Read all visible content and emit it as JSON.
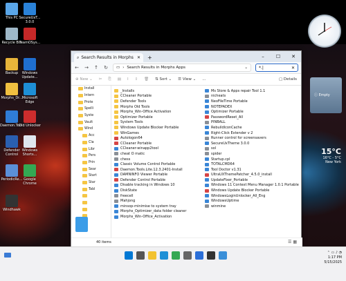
{
  "desktop": {
    "left_icons": [
      {
        "label": "This PC",
        "color": "#5aa6e8"
      },
      {
        "label": "Recycle Bin",
        "color": "#9fb8c8"
      },
      {
        "label": "Backup",
        "color": "#e7b43a"
      },
      {
        "label": "Morphs_Dr...",
        "color": "#f0c040"
      },
      {
        "label": "Daemon.Too...",
        "color": "#2f7cd6"
      },
      {
        "label": "Defender Control",
        "color": "#2a5fb0"
      },
      {
        "label": "PeriodicRe...",
        "color": "#5b8fd8"
      },
      {
        "label": "Windhawk",
        "color": "#333"
      }
    ],
    "right_icons": [
      {
        "label": "SecureUxT... 3.0.0",
        "color": "#2a82d8"
      },
      {
        "label": "TeamOSys...",
        "color": "#c62828"
      },
      {
        "label": "Windows Update...",
        "color": "#1f6fd0"
      },
      {
        "label": "Microsoft Edge",
        "color": "#1e8fd6"
      },
      {
        "label": "Old Unlocker",
        "color": "#cc2d2d"
      },
      {
        "label": "Windows Shorts...",
        "color": "#e0e6ee"
      },
      {
        "label": "Google Chrome",
        "color": "#34a853"
      }
    ]
  },
  "gadgets": {
    "empty_label": "Empty",
    "weather": {
      "temp": "15°C",
      "range": "16°C - 5°C",
      "city": "New York"
    }
  },
  "explorer": {
    "tab_title": "Search Results in Morphs",
    "address": "Search Results in Morphs Apps",
    "search_value": "*.|",
    "toolbar": {
      "new": "New",
      "sort": "Sort",
      "view": "View",
      "more": "...",
      "details": "Details"
    },
    "nav_items": [
      "Install",
      "Intern",
      "Prote",
      "Spelli",
      "Syste",
      "Vault",
      "Wind",
      "Acc",
      "Cla",
      "Libr",
      "Pers",
      "Prin",
      "Sear",
      "Start",
      "Star",
      "Tabl",
      "",
      "",
      "",
      "",
      "",
      ""
    ],
    "files_col1": [
      {
        "name": "_Installs",
        "icon": "folder"
      },
      {
        "name": "CCleaner Portable",
        "icon": "folder"
      },
      {
        "name": "Defender Tools",
        "icon": "folder"
      },
      {
        "name": "Morphs Old Tools",
        "icon": "folder"
      },
      {
        "name": "Morphs_Win-Office Activation",
        "icon": "folder"
      },
      {
        "name": "Optimizer Portable",
        "icon": "folder"
      },
      {
        "name": "System Tools",
        "icon": "folder"
      },
      {
        "name": "Windows Update Blocker Portable",
        "icon": "folder"
      },
      {
        "name": "WinGames",
        "icon": "folder"
      },
      {
        "name": "Autologon64",
        "icon": "app-red"
      },
      {
        "name": "CCleaner Portable",
        "icon": "app-red"
      },
      {
        "name": "CCleaner-winapp2tool",
        "icon": "app-blue"
      },
      {
        "name": "cheat O matic",
        "icon": "app-gray"
      },
      {
        "name": "chess",
        "icon": "app-gray"
      },
      {
        "name": "Classic Volume Control Portable",
        "icon": "app-blue"
      },
      {
        "name": "Daemon.Tools.Lite.12.3.2401-Install",
        "icon": "app-red"
      },
      {
        "name": "DAMNINFO Viewer Portable",
        "icon": "app-blue"
      },
      {
        "name": "Defender Control Portable",
        "icon": "app-red"
      },
      {
        "name": "Disable tracking in Windows 10",
        "icon": "app-blue"
      },
      {
        "name": "DiskState",
        "icon": "app-blue"
      },
      {
        "name": "freecell",
        "icon": "app-gray"
      },
      {
        "name": "Mahjong",
        "icon": "app-gray"
      },
      {
        "name": "minsop-minimise to system tray",
        "icon": "app-blue"
      },
      {
        "name": "Morphs_Optimizer_data folder cleaner",
        "icon": "app-blue"
      },
      {
        "name": "Morphs_Win-Office_Activation",
        "icon": "app-blue"
      }
    ],
    "files_col2": [
      {
        "name": "Ms Store & Apps repair Tool 1.1",
        "icon": "app-blue"
      },
      {
        "name": "nicheats",
        "icon": "app-gray"
      },
      {
        "name": "NeoFileTime Portable",
        "icon": "app-blue"
      },
      {
        "name": "NOTEPADEX",
        "icon": "app-blue"
      },
      {
        "name": "Optimizer Portable",
        "icon": "app-blue"
      },
      {
        "name": "PasswordReset_All",
        "icon": "app-red"
      },
      {
        "name": "PINBALL",
        "icon": "app-gray"
      },
      {
        "name": "RebuildIconCache",
        "icon": "app-blue"
      },
      {
        "name": "Right-Click Extender v 2",
        "icon": "app-blue"
      },
      {
        "name": "Runner control for screensavers",
        "icon": "app-gray"
      },
      {
        "name": "SecureUxTheme 3.0.0",
        "icon": "app-blue"
      },
      {
        "name": "sol",
        "icon": "app-gray"
      },
      {
        "name": "spider",
        "icon": "app-gray"
      },
      {
        "name": "Startup.cpl",
        "icon": "app-blue"
      },
      {
        "name": "TOTALCMD64",
        "icon": "app-blue"
      },
      {
        "name": "Tool Doctor v1.31",
        "icon": "app-blue"
      },
      {
        "name": "UltraUXThemePatcher_4.5.0_install",
        "icon": "app-red"
      },
      {
        "name": "UpdateFixer_Portable",
        "icon": "app-blue"
      },
      {
        "name": "Windows 11 Context Menu Manager 1.0.1 Portable",
        "icon": "app-blue"
      },
      {
        "name": "Windows Update Blocker Portable",
        "icon": "app-red"
      },
      {
        "name": "WindowsLoginUnlocker_All_Eng",
        "icon": "app-blue"
      },
      {
        "name": "WindowsUptime",
        "icon": "app-blue"
      },
      {
        "name": "winmine",
        "icon": "app-gray"
      }
    ],
    "status_count": "40 items"
  },
  "taskbar": {
    "time": "1:17 PM",
    "date": "5/15/2025",
    "apps": [
      {
        "name": "start-icon",
        "color": "#0078d4"
      },
      {
        "name": "search-icon",
        "color": "#555"
      },
      {
        "name": "file-explorer-icon",
        "color": "#f2c230"
      },
      {
        "name": "edge-icon",
        "color": "#1e8fd6"
      },
      {
        "name": "chrome-icon",
        "color": "#34a853"
      },
      {
        "name": "settings-icon",
        "color": "#666"
      },
      {
        "name": "store-icon",
        "color": "#2b6fd8"
      },
      {
        "name": "terminal-icon",
        "color": "#333"
      },
      {
        "name": "control-panel-icon",
        "color": "#3a8fd8"
      }
    ]
  },
  "colors": {
    "accent": "#0078d4",
    "folder": "#f5c542"
  }
}
